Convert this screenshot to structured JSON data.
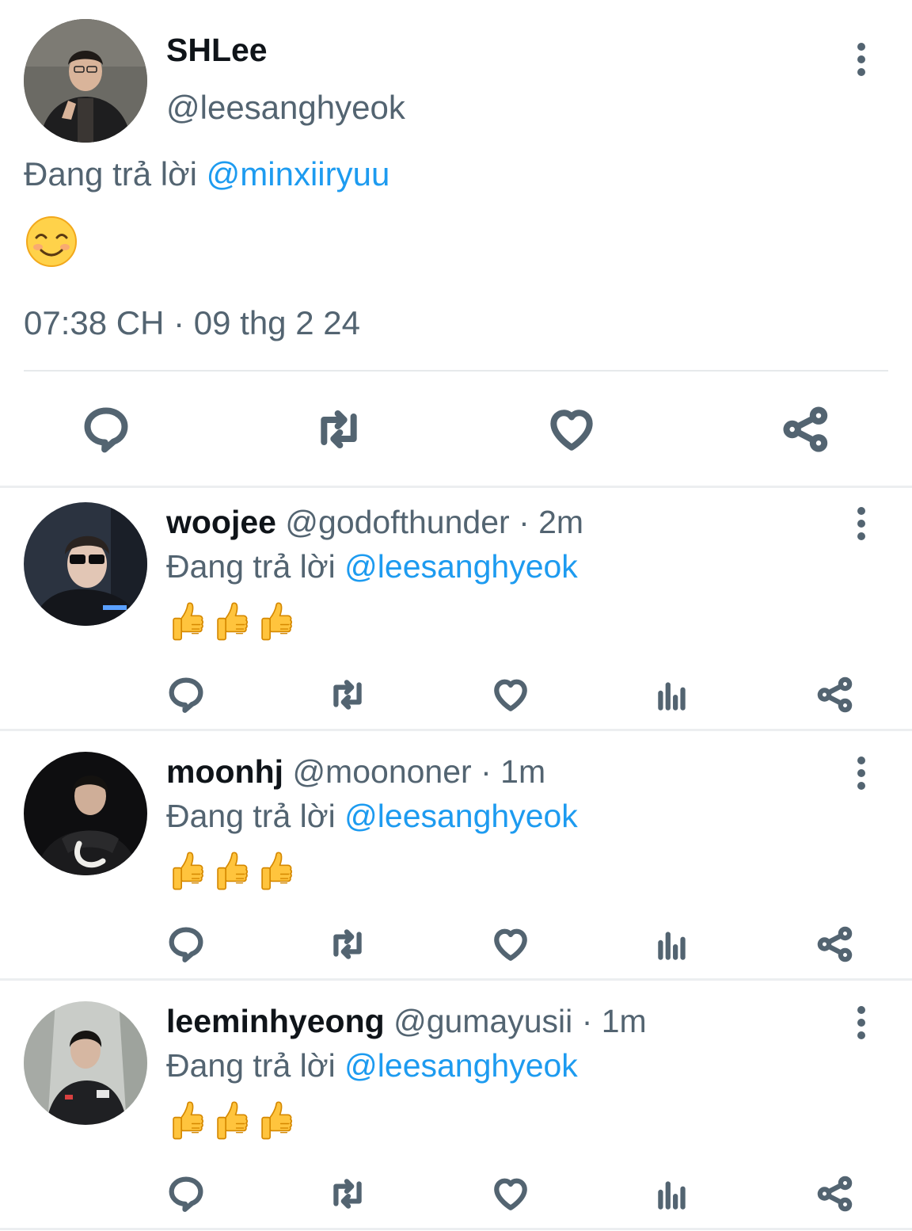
{
  "main_tweet": {
    "display_name": "SHLee",
    "handle": "@leesanghyeok",
    "replying_prefix": "Đang trả lời",
    "replying_to": "@minxiiryuu",
    "content_emoji": "smiling-face-with-smiling-eyes",
    "timestamp": "07:38 CH · 09 thg 2 24",
    "actions": [
      "reply-icon",
      "retweet-icon",
      "like-icon",
      "share-icon"
    ]
  },
  "replies": [
    {
      "display_name": "woojee",
      "handle": "@godofthunder",
      "time": "· 2m",
      "replying_prefix": "Đang trả lời",
      "replying_to": "@leesanghyeok",
      "content_emoji": "thumbs-up x3"
    },
    {
      "display_name": "moonhj",
      "handle": "@moononer",
      "time": "· 1m",
      "replying_prefix": "Đang trả lời",
      "replying_to": "@leesanghyeok",
      "content_emoji": "thumbs-up x3"
    },
    {
      "display_name": "leeminhyeong",
      "handle": "@gumayusii",
      "time": "· 1m",
      "replying_prefix": "Đang trả lời",
      "replying_to": "@leesanghyeok",
      "content_emoji": "thumbs-up x3"
    }
  ],
  "colors": {
    "text_primary": "#0f1419",
    "text_secondary": "#536471",
    "link": "#1d9bf0",
    "divider": "#e6e9eb"
  }
}
